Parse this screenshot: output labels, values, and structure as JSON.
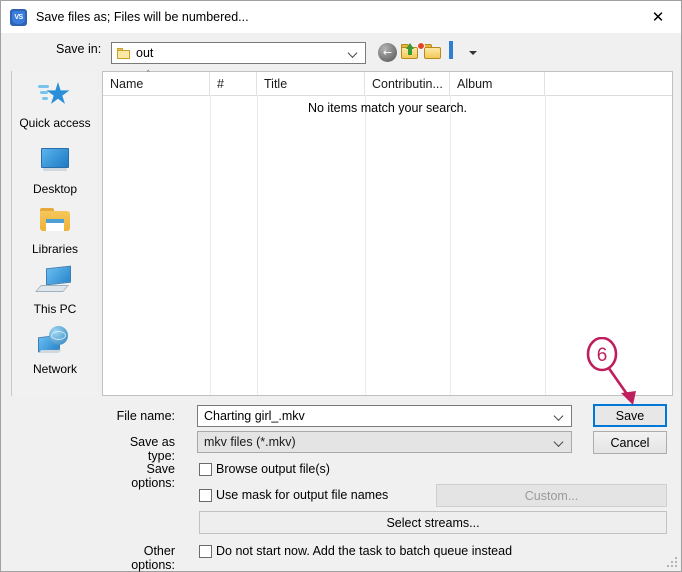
{
  "window": {
    "title": "Save files as; Files will be numbered...",
    "app_icon": "vs-shield-icon",
    "close_label": "✕"
  },
  "toolbar": {
    "save_in_label": "Save in:",
    "save_in_value": "out",
    "back_icon": "back-arrow-icon",
    "up_icon": "up-one-level-icon",
    "new_folder_icon": "new-folder-icon",
    "view_icon": "view-options-icon"
  },
  "places": [
    {
      "label": "Quick access",
      "icon": "quick-access-star-icon"
    },
    {
      "label": "Desktop",
      "icon": "desktop-monitor-icon"
    },
    {
      "label": "Libraries",
      "icon": "libraries-folder-icon"
    },
    {
      "label": "This PC",
      "icon": "this-pc-computer-icon"
    },
    {
      "label": "Network",
      "icon": "network-globe-icon"
    }
  ],
  "file_list": {
    "columns": [
      {
        "label": "Name",
        "sorted": "ascending",
        "sort_glyph": "˄"
      },
      {
        "label": "#"
      },
      {
        "label": "Title"
      },
      {
        "label": "Contributin..."
      },
      {
        "label": "Album"
      },
      {
        "label": ""
      }
    ],
    "empty_message": "No items match your search.",
    "rows": []
  },
  "form": {
    "file_name_label": "File name:",
    "file_name_value": "Charting girl_.mkv",
    "file_name_placeholder": "File name",
    "save_as_type_label": "Save as type:",
    "save_as_type_value": "mkv files (*.mkv)",
    "save_options_label": "Save options:",
    "other_options_label": "Other options:",
    "browse_output_label": "Browse output file(s)",
    "browse_output_checked": false,
    "use_mask_label": "Use mask for output file names",
    "use_mask_checked": false,
    "custom_label": "Custom...",
    "custom_enabled": false,
    "select_streams_label": "Select streams...",
    "batch_queue_label": "Do not start now. Add the task to batch queue instead",
    "batch_queue_checked": false
  },
  "buttons": {
    "save_label": "Save",
    "cancel_label": "Cancel"
  },
  "annotation": {
    "step_number": "6",
    "color": "#bf1e5d",
    "points_to": "save-button"
  }
}
